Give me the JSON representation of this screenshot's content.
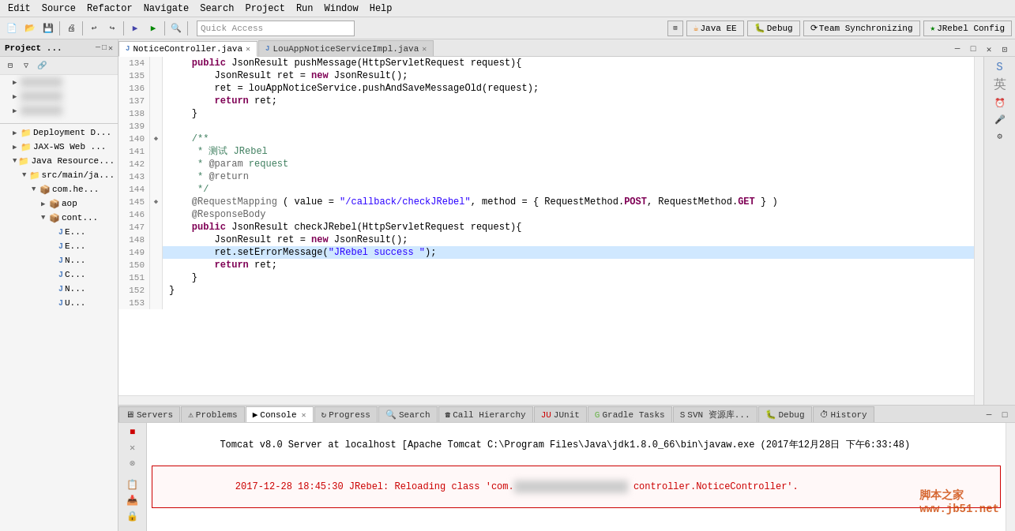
{
  "menubar": {
    "items": [
      "Edit",
      "Source",
      "Refactor",
      "Navigate",
      "Search",
      "Project",
      "Run",
      "Window",
      "Help"
    ]
  },
  "toolbar": {
    "quick_access_label": "Quick Access",
    "right_buttons": [
      "Java EE",
      "Debug",
      "Team Synchronizing",
      "JRebel Config"
    ]
  },
  "left_panel": {
    "title": "Project ...",
    "tree": [
      {
        "label": "Deployment D...",
        "indent": 1,
        "type": "folder",
        "expanded": false
      },
      {
        "label": "JAX-WS Web ...",
        "indent": 1,
        "type": "folder",
        "expanded": false
      },
      {
        "label": "Java Resource...",
        "indent": 1,
        "type": "folder",
        "expanded": true
      },
      {
        "label": "src/main/ja...",
        "indent": 2,
        "type": "folder",
        "expanded": true
      },
      {
        "label": "com.he...",
        "indent": 3,
        "type": "folder",
        "expanded": true
      },
      {
        "label": "aop",
        "indent": 4,
        "type": "folder",
        "expanded": false
      },
      {
        "label": "cont...",
        "indent": 4,
        "type": "folder",
        "expanded": true
      },
      {
        "label": "E...",
        "indent": 5,
        "type": "java",
        "expanded": false
      },
      {
        "label": "E...",
        "indent": 5,
        "type": "java",
        "expanded": false
      },
      {
        "label": "N...",
        "indent": 5,
        "type": "java",
        "expanded": false
      },
      {
        "label": "C...",
        "indent": 5,
        "type": "java",
        "expanded": false
      },
      {
        "label": "N...",
        "indent": 5,
        "type": "java",
        "expanded": false
      },
      {
        "label": "U...",
        "indent": 5,
        "type": "java",
        "expanded": false
      }
    ]
  },
  "editor": {
    "tabs": [
      {
        "label": "NoticeController.java",
        "active": true,
        "modified": false
      },
      {
        "label": "LouAppNoticeServiceImpl.java",
        "active": false,
        "modified": false
      }
    ],
    "lines": [
      {
        "num": 134,
        "marker": "",
        "content": "    public JsonResult pushMessage(HttpServletRequest request){",
        "tokens": [
          {
            "text": "    ",
            "cls": ""
          },
          {
            "text": "public",
            "cls": "kw"
          },
          {
            "text": " JsonResult pushMessage(HttpServletRequest request){",
            "cls": ""
          }
        ]
      },
      {
        "num": 135,
        "marker": "",
        "content": "        JsonResult ret = new JsonResult();",
        "tokens": [
          {
            "text": "        JsonResult ret = ",
            "cls": ""
          },
          {
            "text": "new",
            "cls": "kw"
          },
          {
            "text": " JsonResult();",
            "cls": ""
          }
        ]
      },
      {
        "num": 136,
        "marker": "",
        "content": "        ret = louAppNoticeService.pushAndSaveMessageOld(request);",
        "tokens": [
          {
            "text": "        ret = louAppNoticeService.pushAndSaveMessageOld(request);",
            "cls": ""
          }
        ]
      },
      {
        "num": 137,
        "marker": "",
        "content": "        return ret;",
        "tokens": [
          {
            "text": "        ",
            "cls": ""
          },
          {
            "text": "return",
            "cls": "kw"
          },
          {
            "text": " ret;",
            "cls": ""
          }
        ]
      },
      {
        "num": 138,
        "marker": "",
        "content": "    }",
        "tokens": [
          {
            "text": "    }",
            "cls": ""
          }
        ]
      },
      {
        "num": 139,
        "marker": "",
        "content": "",
        "tokens": []
      },
      {
        "num": 140,
        "marker": "◆",
        "content": "    /**",
        "tokens": [
          {
            "text": "    /**",
            "cls": "cm"
          }
        ]
      },
      {
        "num": 141,
        "marker": "",
        "content": "     * 测试 JRebel",
        "tokens": [
          {
            "text": "     * 测试 JRebel",
            "cls": "cm"
          }
        ]
      },
      {
        "num": 142,
        "marker": "",
        "content": "     * @param request",
        "tokens": [
          {
            "text": "     * ",
            "cls": "cm"
          },
          {
            "text": "@param",
            "cls": "param-ann"
          },
          {
            "text": " request",
            "cls": "cm"
          }
        ]
      },
      {
        "num": 143,
        "marker": "",
        "content": "     * @return",
        "tokens": [
          {
            "text": "     * ",
            "cls": "cm"
          },
          {
            "text": "@return",
            "cls": "param-ann"
          }
        ]
      },
      {
        "num": 144,
        "marker": "",
        "content": "     */",
        "tokens": [
          {
            "text": "     */",
            "cls": "cm"
          }
        ]
      },
      {
        "num": 145,
        "marker": "◆",
        "content": "    @RequestMapping ( value = \"/callback/checkJRebel\", method = { RequestMethod.POST, RequestMethod.GET } )",
        "tokens": [
          {
            "text": "    ",
            "cls": ""
          },
          {
            "text": "@RequestMapping",
            "cls": "ann"
          },
          {
            "text": " ( value = ",
            "cls": ""
          },
          {
            "text": "\"/callback/checkJRebel\"",
            "cls": "str"
          },
          {
            "text": ", method = { RequestMethod.",
            "cls": ""
          },
          {
            "text": "POST",
            "cls": "kw"
          },
          {
            "text": ", RequestMethod.",
            "cls": ""
          },
          {
            "text": "GET",
            "cls": "kw"
          },
          {
            "text": " } )",
            "cls": ""
          }
        ]
      },
      {
        "num": 146,
        "marker": "",
        "content": "    @ResponseBody",
        "tokens": [
          {
            "text": "    ",
            "cls": ""
          },
          {
            "text": "@ResponseBody",
            "cls": "ann"
          }
        ]
      },
      {
        "num": 147,
        "marker": "",
        "content": "    public JsonResult checkJRebel(HttpServletRequest request){",
        "tokens": [
          {
            "text": "    ",
            "cls": ""
          },
          {
            "text": "public",
            "cls": "kw"
          },
          {
            "text": " JsonResult checkJRebel(HttpServletRequest request){",
            "cls": ""
          }
        ]
      },
      {
        "num": 148,
        "marker": "",
        "content": "        JsonResult ret = new JsonResult();",
        "tokens": [
          {
            "text": "        JsonResult ret = ",
            "cls": ""
          },
          {
            "text": "new",
            "cls": "kw"
          },
          {
            "text": " JsonResult();",
            "cls": ""
          }
        ]
      },
      {
        "num": 149,
        "marker": "",
        "content": "        ret.setErrorMessage(\"JRebel success \");",
        "tokens": [
          {
            "text": "        ret.setErrorMessage(",
            "cls": ""
          },
          {
            "text": "\"JRebel success \"",
            "cls": "str"
          },
          {
            "text": ");",
            "cls": ""
          }
        ],
        "highlight": true
      },
      {
        "num": 150,
        "marker": "",
        "content": "        return ret;",
        "tokens": [
          {
            "text": "        ",
            "cls": ""
          },
          {
            "text": "return",
            "cls": "kw"
          },
          {
            "text": " ret;",
            "cls": ""
          }
        ]
      },
      {
        "num": 151,
        "marker": "",
        "content": "    }",
        "tokens": [
          {
            "text": "    }",
            "cls": ""
          }
        ]
      },
      {
        "num": 152,
        "marker": "",
        "content": "}",
        "tokens": [
          {
            "text": "}",
            "cls": ""
          }
        ]
      },
      {
        "num": 153,
        "marker": "",
        "content": "",
        "tokens": []
      }
    ]
  },
  "bottom_panel": {
    "tabs": [
      {
        "label": "Servers",
        "icon": "🖧",
        "active": false
      },
      {
        "label": "Problems",
        "icon": "⚠",
        "active": false
      },
      {
        "label": "Console",
        "icon": "▶",
        "active": true
      },
      {
        "label": "Progress",
        "icon": "↻",
        "active": false
      },
      {
        "label": "Search",
        "icon": "🔍",
        "active": false
      },
      {
        "label": "Call Hierarchy",
        "icon": "☎",
        "active": false
      },
      {
        "label": "JUnit",
        "icon": "✓",
        "active": false
      },
      {
        "label": "Gradle Tasks",
        "icon": "G",
        "active": false
      },
      {
        "label": "SVN 资源库...",
        "icon": "S",
        "active": false
      },
      {
        "label": "Debug",
        "icon": "🐛",
        "active": false
      },
      {
        "label": "History",
        "icon": "⏱",
        "active": false
      }
    ],
    "console_lines": [
      {
        "text": "Tomcat v8.0 Server at localhost [Apache Tomcat C:\\Program Files\\Java\\jdk1.8.0_66\\bin\\javaw.exe (2017年12月28日 下午6:33:48)",
        "cls": "normal"
      },
      {
        "text": "2017-12-28 18:45:30 JRebel: Reloading class 'com.█████████████████████ controller.NoticeController'.",
        "cls": "error",
        "box": true
      }
    ],
    "toolbar_buttons": [
      "■",
      "✕",
      "⊗",
      "📋",
      "⤓",
      "⤒",
      "□",
      "□",
      "⤵",
      "📷",
      "📤",
      "▾"
    ]
  },
  "watermark": "脚本之家\nwww.jb51.net"
}
